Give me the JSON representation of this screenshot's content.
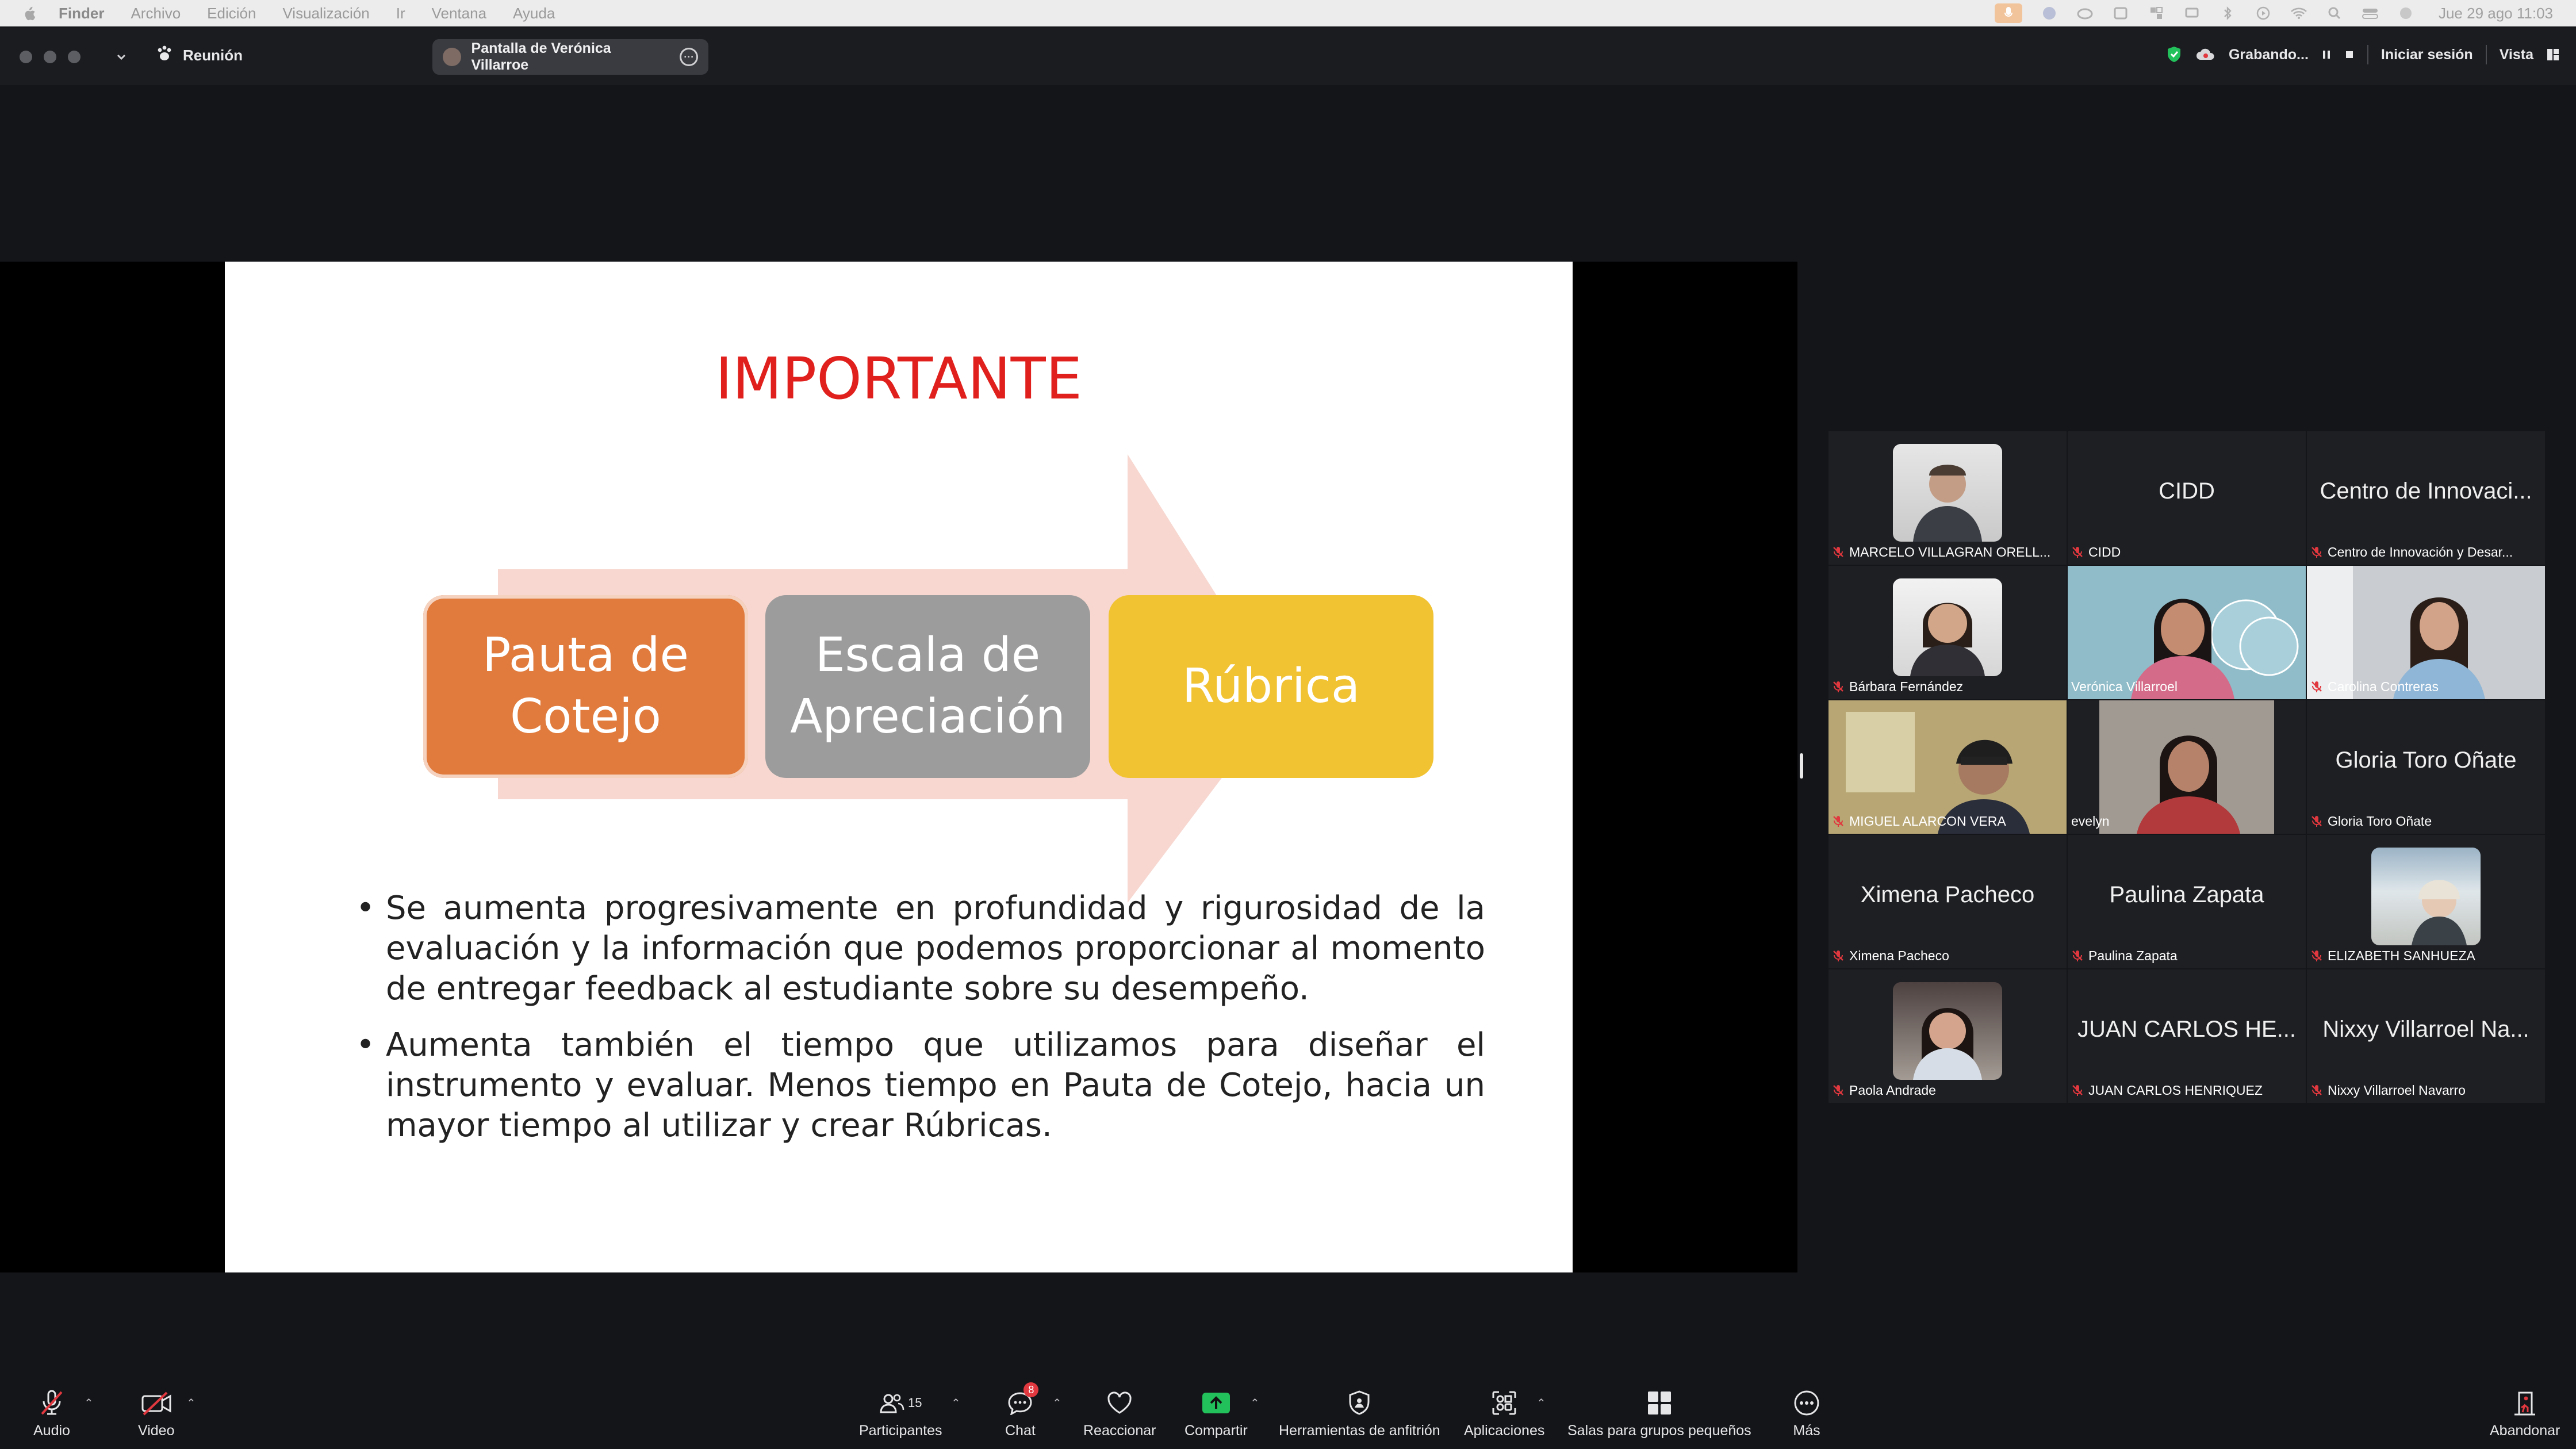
{
  "menubar": {
    "app": "Finder",
    "items": [
      "Archivo",
      "Edición",
      "Visualización",
      "Ir",
      "Ventana",
      "Ayuda"
    ],
    "clock": "Jue 29 ago  11:03"
  },
  "titlebar": {
    "meeting_label": "Reunión",
    "share_label": "Pantalla de Verónica Villarroe",
    "recording_label": "Grabando...",
    "signin_label": "Iniciar sesión",
    "view_label": "Vista"
  },
  "slide": {
    "title": "IMPORTANTE",
    "box1_line1": "Pauta de",
    "box1_line2": "Cotejo",
    "box2_line1": "Escala de",
    "box2_line2": "Apreciación",
    "box3": "Rúbrica",
    "bullet1": "Se aumenta progresivamente en profundidad y rigurosidad de la evaluación y la información que podemos proporcionar al momento de entregar feedback al estudiante sobre su desempeño.",
    "bullet2": "Aumenta también el tiempo que utilizamos para diseñar el instrumento y evaluar. Menos tiempo en Pauta de Cotejo, hacia un mayor tiempo al utilizar y crear Rúbricas.",
    "colors": {
      "title": "#e0201c",
      "box1": "#e07b3d",
      "box2": "#9c9c9c",
      "box3": "#f1c232",
      "arrow": "#f6d6cf"
    }
  },
  "participants": [
    {
      "name": "MARCELO VILLAGRAN ORELL...",
      "big": "",
      "kind": "photo"
    },
    {
      "name": "CIDD",
      "big": "CIDD",
      "kind": "text"
    },
    {
      "name": "Centro de Innovación y Desar...",
      "big": "Centro de Innovaci...",
      "kind": "text"
    },
    {
      "name": "Bárbara Fernández",
      "big": "",
      "kind": "photo"
    },
    {
      "name": "Verónica Villarroel",
      "big": "",
      "kind": "video",
      "active": true
    },
    {
      "name": "Carolina Contreras",
      "big": "",
      "kind": "video"
    },
    {
      "name": "MIGUEL ALARCON VERA",
      "big": "",
      "kind": "video"
    },
    {
      "name": "evelyn",
      "big": "",
      "kind": "video"
    },
    {
      "name": "Gloria Toro Oñate",
      "big": "Gloria Toro Oñate",
      "kind": "text"
    },
    {
      "name": "Ximena Pacheco",
      "big": "Ximena Pacheco",
      "kind": "text"
    },
    {
      "name": "Paulina Zapata",
      "big": "Paulina Zapata",
      "kind": "text"
    },
    {
      "name": "ELIZABETH SANHUEZA",
      "big": "",
      "kind": "photo"
    },
    {
      "name": "Paola Andrade",
      "big": "",
      "kind": "photo"
    },
    {
      "name": "JUAN CARLOS HENRIQUEZ",
      "big": "JUAN CARLOS HE...",
      "kind": "text"
    },
    {
      "name": "Nixxy Villarroel Navarro",
      "big": "Nixxy Villarroel Na...",
      "kind": "text"
    }
  ],
  "toolbar": {
    "audio": "Audio",
    "video": "Video",
    "participants": "Participantes",
    "participants_count": "15",
    "chat": "Chat",
    "chat_badge": "8",
    "react": "Reaccionar",
    "share": "Compartir",
    "host_tools": "Herramientas de anfitrión",
    "apps": "Aplicaciones",
    "breakout": "Salas para grupos pequeños",
    "more": "Más",
    "leave": "Abandonar",
    "share_color": "#23c15b",
    "mute_color": "#e0383e"
  }
}
